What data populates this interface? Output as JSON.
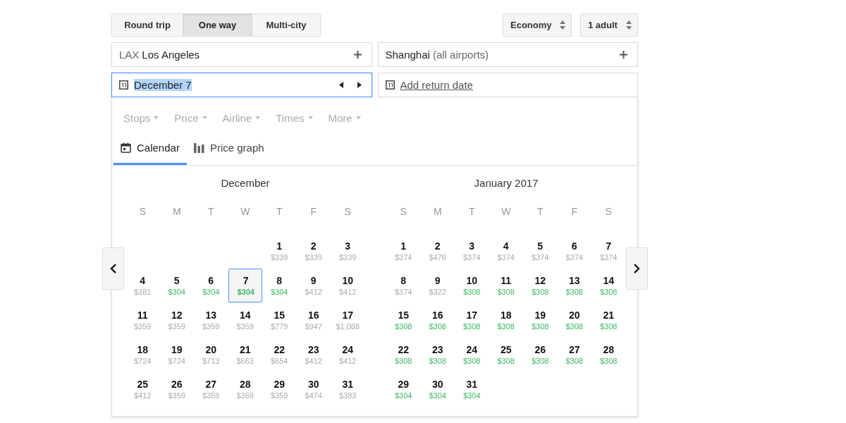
{
  "trip_types": [
    {
      "label": "Round trip",
      "selected": false
    },
    {
      "label": "One way",
      "selected": true
    },
    {
      "label": "Multi-city",
      "selected": false
    }
  ],
  "cabin": {
    "value": "Economy"
  },
  "passengers": {
    "value": "1 adult"
  },
  "origin": {
    "code": "LAX",
    "city": "Los Angeles"
  },
  "destination": {
    "city": "Shanghai",
    "note": "(all airports)"
  },
  "departure": {
    "value": "December 7"
  },
  "return": {
    "link": "Add return date"
  },
  "filters": [
    "Stops",
    "Price",
    "Airline",
    "Times",
    "More"
  ],
  "view_tabs": [
    {
      "label": "Calendar",
      "selected": true
    },
    {
      "label": "Price graph",
      "selected": false
    }
  ],
  "months": [
    {
      "title": "December",
      "weekdays": [
        "S",
        "M",
        "T",
        "W",
        "T",
        "F",
        "S"
      ],
      "weeks": [
        [
          {
            "day": "1",
            "price": "$339",
            "cheap": false,
            "selected": false
          },
          {
            "day": "2",
            "price": "$339",
            "cheap": false,
            "selected": false
          },
          {
            "day": "3",
            "price": "$339",
            "cheap": false,
            "selected": false
          }
        ],
        [
          {
            "day": "4",
            "price": "$381",
            "cheap": false,
            "selected": false
          },
          {
            "day": "5",
            "price": "$304",
            "cheap": true,
            "selected": false
          },
          {
            "day": "6",
            "price": "$304",
            "cheap": true,
            "selected": false
          },
          {
            "day": "7",
            "price": "$304",
            "cheap": true,
            "selected": true
          },
          {
            "day": "8",
            "price": "$304",
            "cheap": true,
            "selected": false
          },
          {
            "day": "9",
            "price": "$412",
            "cheap": false,
            "selected": false
          },
          {
            "day": "10",
            "price": "$412",
            "cheap": false,
            "selected": false
          }
        ],
        [
          {
            "day": "11",
            "price": "$359",
            "cheap": false,
            "selected": false
          },
          {
            "day": "12",
            "price": "$359",
            "cheap": false,
            "selected": false
          },
          {
            "day": "13",
            "price": "$359",
            "cheap": false,
            "selected": false
          },
          {
            "day": "14",
            "price": "$359",
            "cheap": false,
            "selected": false
          },
          {
            "day": "15",
            "price": "$779",
            "cheap": false,
            "selected": false
          },
          {
            "day": "16",
            "price": "$947",
            "cheap": false,
            "selected": false
          },
          {
            "day": "17",
            "price": "$1,088",
            "cheap": false,
            "selected": false
          }
        ],
        [
          {
            "day": "18",
            "price": "$724",
            "cheap": false,
            "selected": false
          },
          {
            "day": "19",
            "price": "$724",
            "cheap": false,
            "selected": false
          },
          {
            "day": "20",
            "price": "$713",
            "cheap": false,
            "selected": false
          },
          {
            "day": "21",
            "price": "$663",
            "cheap": false,
            "selected": false
          },
          {
            "day": "22",
            "price": "$654",
            "cheap": false,
            "selected": false
          },
          {
            "day": "23",
            "price": "$412",
            "cheap": false,
            "selected": false
          },
          {
            "day": "24",
            "price": "$412",
            "cheap": false,
            "selected": false
          }
        ],
        [
          {
            "day": "25",
            "price": "$412",
            "cheap": false,
            "selected": false
          },
          {
            "day": "26",
            "price": "$359",
            "cheap": false,
            "selected": false
          },
          {
            "day": "27",
            "price": "$359",
            "cheap": false,
            "selected": false
          },
          {
            "day": "28",
            "price": "$359",
            "cheap": false,
            "selected": false
          },
          {
            "day": "29",
            "price": "$359",
            "cheap": false,
            "selected": false
          },
          {
            "day": "30",
            "price": "$474",
            "cheap": false,
            "selected": false
          },
          {
            "day": "31",
            "price": "$383",
            "cheap": false,
            "selected": false
          }
        ]
      ]
    },
    {
      "title": "January 2017",
      "weekdays": [
        "S",
        "M",
        "T",
        "W",
        "T",
        "F",
        "S"
      ],
      "weeks": [
        [
          {
            "day": "1",
            "price": "$374",
            "cheap": false,
            "selected": false
          },
          {
            "day": "2",
            "price": "$476",
            "cheap": false,
            "selected": false
          },
          {
            "day": "3",
            "price": "$374",
            "cheap": false,
            "selected": false
          },
          {
            "day": "4",
            "price": "$374",
            "cheap": false,
            "selected": false
          },
          {
            "day": "5",
            "price": "$374",
            "cheap": false,
            "selected": false
          },
          {
            "day": "6",
            "price": "$374",
            "cheap": false,
            "selected": false
          },
          {
            "day": "7",
            "price": "$374",
            "cheap": false,
            "selected": false
          }
        ],
        [
          {
            "day": "8",
            "price": "$374",
            "cheap": false,
            "selected": false
          },
          {
            "day": "9",
            "price": "$322",
            "cheap": false,
            "selected": false
          },
          {
            "day": "10",
            "price": "$308",
            "cheap": true,
            "selected": false
          },
          {
            "day": "11",
            "price": "$308",
            "cheap": true,
            "selected": false
          },
          {
            "day": "12",
            "price": "$308",
            "cheap": true,
            "selected": false
          },
          {
            "day": "13",
            "price": "$308",
            "cheap": true,
            "selected": false
          },
          {
            "day": "14",
            "price": "$308",
            "cheap": true,
            "selected": false
          }
        ],
        [
          {
            "day": "15",
            "price": "$308",
            "cheap": true,
            "selected": false
          },
          {
            "day": "16",
            "price": "$308",
            "cheap": true,
            "selected": false
          },
          {
            "day": "17",
            "price": "$308",
            "cheap": true,
            "selected": false
          },
          {
            "day": "18",
            "price": "$308",
            "cheap": true,
            "selected": false
          },
          {
            "day": "19",
            "price": "$308",
            "cheap": true,
            "selected": false
          },
          {
            "day": "20",
            "price": "$308",
            "cheap": true,
            "selected": false
          },
          {
            "day": "21",
            "price": "$308",
            "cheap": true,
            "selected": false
          }
        ],
        [
          {
            "day": "22",
            "price": "$308",
            "cheap": true,
            "selected": false
          },
          {
            "day": "23",
            "price": "$308",
            "cheap": true,
            "selected": false
          },
          {
            "day": "24",
            "price": "$308",
            "cheap": true,
            "selected": false
          },
          {
            "day": "25",
            "price": "$308",
            "cheap": true,
            "selected": false
          },
          {
            "day": "26",
            "price": "$308",
            "cheap": true,
            "selected": false
          },
          {
            "day": "27",
            "price": "$308",
            "cheap": true,
            "selected": false
          },
          {
            "day": "28",
            "price": "$308",
            "cheap": true,
            "selected": false
          }
        ],
        [
          {
            "day": "29",
            "price": "$304",
            "cheap": true,
            "selected": false
          },
          {
            "day": "30",
            "price": "$304",
            "cheap": true,
            "selected": false
          },
          {
            "day": "31",
            "price": "$304",
            "cheap": true,
            "selected": false
          }
        ]
      ]
    }
  ]
}
